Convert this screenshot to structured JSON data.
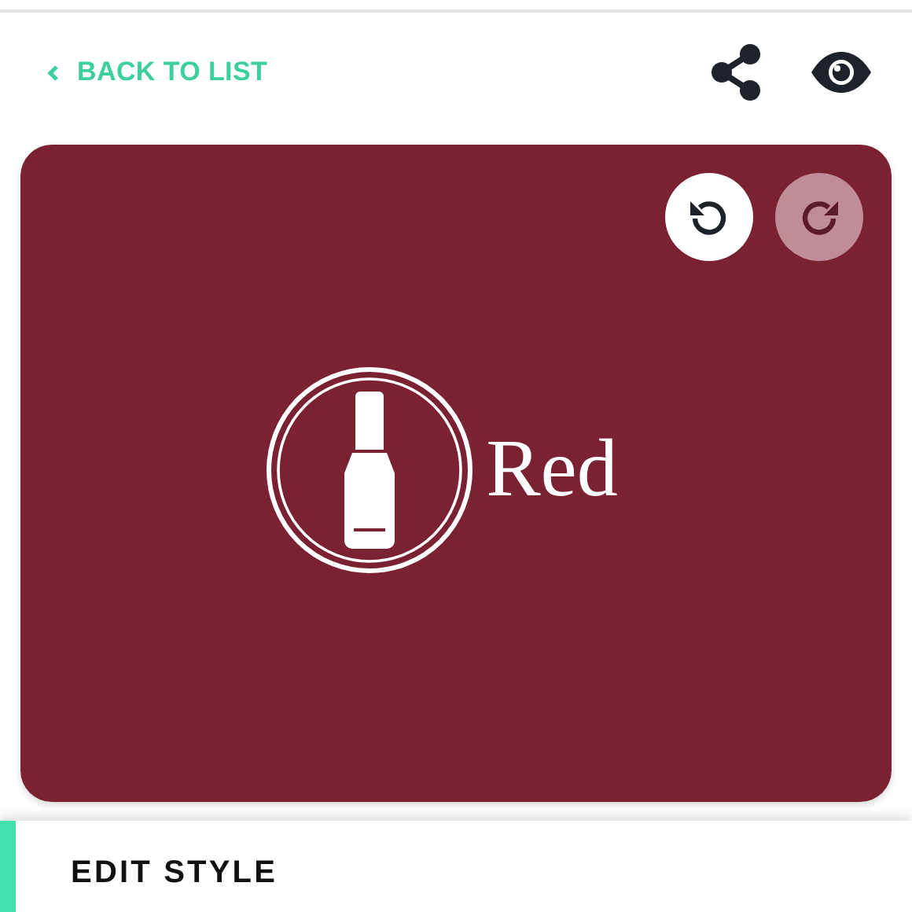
{
  "header": {
    "back_link": "BACK TO LIST"
  },
  "canvas": {
    "history_buttons": [
      {
        "kind": "undo",
        "disabled": false
      },
      {
        "kind": "redo",
        "disabled": true
      }
    ],
    "logo_text": "Red"
  },
  "panel": {
    "title": "EDIT STYLE"
  }
}
